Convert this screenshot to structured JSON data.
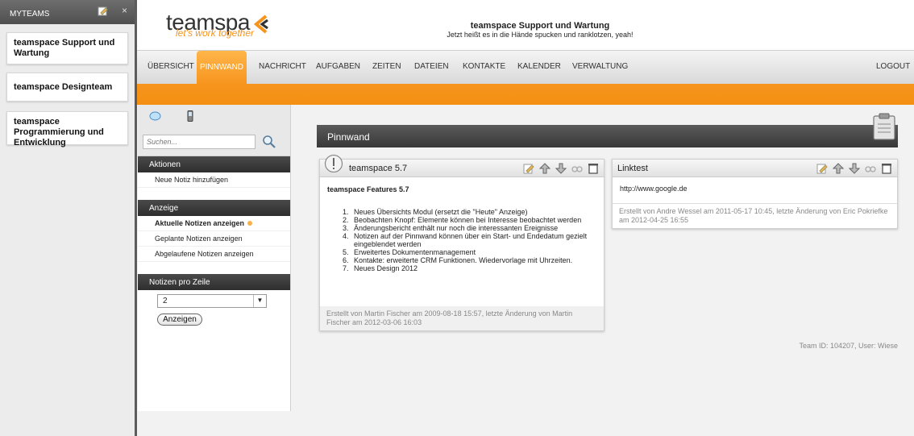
{
  "teams_panel": {
    "header": "MYTEAMS",
    "close_glyph": "×",
    "teams": [
      {
        "label": "teamspace Support und Wartung"
      },
      {
        "label": "teamspace Designteam"
      },
      {
        "label": "teamspace Programmierung und Entwicklung"
      }
    ]
  },
  "header": {
    "logo_text": "teamspa",
    "logo_tagline": "let's work together",
    "team_title": "teamspace Support und Wartung",
    "team_subtitle": "Jetzt heißt es in die Hände spucken und ranklotzen, yeah!"
  },
  "nav": {
    "items": [
      "ÜBERSICHT",
      "PINNWAND",
      "NACHRICHT",
      "AUFGABEN",
      "ZEITEN",
      "DATEIEN",
      "KONTAKTE",
      "KALENDER",
      "VERWALTUNG"
    ],
    "logout": "LOGOUT",
    "active": "PINNWAND"
  },
  "sidebar": {
    "search_placeholder": "Suchen...",
    "actions_title": "Aktionen",
    "actions": [
      "Neue Notiz hinzufügen"
    ],
    "view_title": "Anzeige",
    "view_links": [
      "Aktuelle Notizen anzeigen",
      "Geplante Notizen anzeigen",
      "Abgelaufene Notizen anzeigen"
    ],
    "per_row_title": "Notizen pro Zeile",
    "per_row_value": "2",
    "show_button": "Anzeigen"
  },
  "main": {
    "title": "Pinnwand",
    "notes": [
      {
        "title": "teamspace 5.7",
        "heading": "teamspace Features 5.7",
        "items": [
          "Neues Übersichts Modul (ersetzt die \"Heute\" Anzeige)",
          "Beobachten Knopf: Elemente können bei Interesse beobachtet werden",
          "Änderungsbericht enthält nur noch die interessanten Ereignisse",
          "Notizen auf der Pinnwand können über ein Start- und Endedatum gezielt eingeblendet werden",
          "Erweitertes Dokumentenmanagement",
          "Kontakte: erweiterte CRM Funktionen. Wiedervorlage mit Uhrzeiten.",
          "Neues Design 2012"
        ],
        "footer": "Erstellt von Martin Fischer am 2009-08-18 15:57, letzte Änderung von Martin Fischer am 2012-03-06 16:03"
      },
      {
        "title": "Linktest",
        "body": "http://www.google.de",
        "footer": "Erstellt von Andre Wessel am 2011-05-17 10:45, letzte Änderung von Eric Pokriefke am 2012-04-25 16:55"
      }
    ],
    "team_info": "Team ID: 104207, User: Wiese"
  },
  "colors": {
    "accent": "#f7941d",
    "dark_bar": "#3a3a3a"
  },
  "icons": [
    "edit-icon",
    "arrow-up-icon",
    "arrow-down-icon",
    "watch-icon",
    "delete-icon",
    "chat-icon",
    "mobile-icon",
    "search-icon",
    "clipboard-icon",
    "exclamation-icon"
  ]
}
